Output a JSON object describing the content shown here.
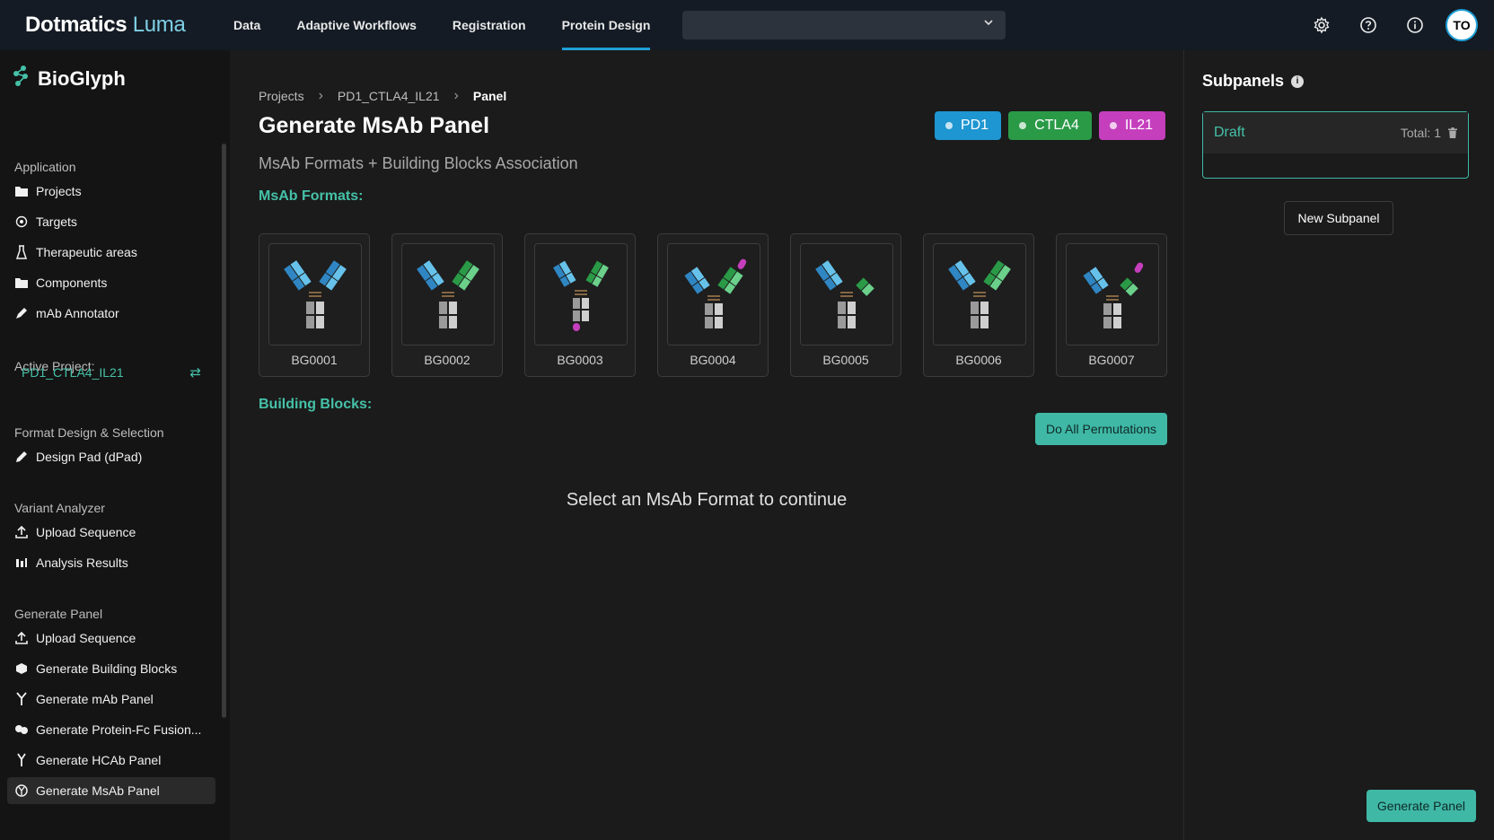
{
  "topbar": {
    "brand_bold": "Dotmatics",
    "brand_light": "Luma",
    "nav": [
      "Data",
      "Adaptive Workflows",
      "Registration",
      "Protein Design"
    ],
    "active_nav": "Protein Design",
    "select_value": "",
    "avatar": "TO",
    "icons": [
      "gear-icon",
      "help-icon",
      "info-icon"
    ]
  },
  "sidebar": {
    "brand": "BioGlyph",
    "application_label": "Application",
    "application_items": [
      "Projects",
      "Targets",
      "Therapeutic areas",
      "Components",
      "mAb Annotator"
    ],
    "active_project_label": "Active Project:",
    "active_project": "PD1_CTLA4_IL21",
    "format_label": "Format Design & Selection",
    "format_items": [
      "Design Pad (dPad)"
    ],
    "variant_label": "Variant Analyzer",
    "variant_items": [
      "Upload Sequence",
      "Analysis Results"
    ],
    "generate_label": "Generate Panel",
    "generate_items": [
      "Upload Sequence",
      "Generate Building Blocks",
      "Generate mAb Panel",
      "Generate Protein-Fc Fusion...",
      "Generate HCAb Panel",
      "Generate MsAb Panel"
    ],
    "active_item": "Generate MsAb Panel"
  },
  "main": {
    "breadcrumbs": [
      "Projects",
      "PD1_CTLA4_IL21",
      "Panel"
    ],
    "title": "Generate MsAb Panel",
    "subtitle": "MsAb Formats + Building Blocks Association",
    "tags": [
      {
        "label": "PD1",
        "color": "#1e96d1"
      },
      {
        "label": "CTLA4",
        "color": "#2a9a47"
      },
      {
        "label": "IL21",
        "color": "#c53fbd"
      }
    ],
    "formats_label": "MsAb Formats:",
    "formats": [
      "BG0001",
      "BG0002",
      "BG0003",
      "BG0004",
      "BG0005",
      "BG0006",
      "BG0007"
    ],
    "building_blocks_label": "Building Blocks:",
    "permutations_button": "Do All Permutations",
    "empty_message": "Select an MsAb Format to continue"
  },
  "right_panel": {
    "title": "Subpanels",
    "draft_name": "Draft",
    "draft_total": "Total: 1",
    "new_subpanel_button": "New Subpanel",
    "generate_button": "Generate Panel"
  }
}
